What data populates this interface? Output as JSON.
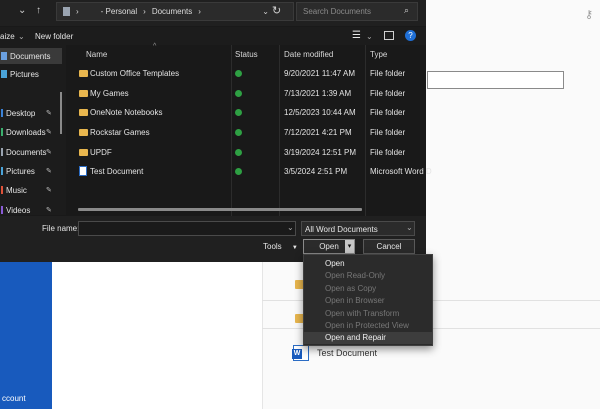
{
  "background": {
    "account_label": "ccount",
    "recent_doc": "Test Document"
  },
  "topbar": {
    "address_segments": [
      "›",
      "- Personal",
      "›",
      "Documents",
      "›"
    ],
    "search_placeholder": "Search Documents"
  },
  "toolbar": {
    "left_label": "aize",
    "new_folder": "New folder"
  },
  "sidebar": {
    "items": [
      {
        "label": "Documents",
        "icon": "documents-icon",
        "selected": true
      },
      {
        "label": "Pictures",
        "icon": "pictures-icon",
        "selected": false
      },
      {
        "label": "Desktop",
        "icon": "desktop-icon",
        "pinned": true
      },
      {
        "label": "Downloads",
        "icon": "downloads-icon",
        "pinned": true
      },
      {
        "label": "Documents",
        "icon": "documents-icon",
        "pinned": true
      },
      {
        "label": "Pictures",
        "icon": "pictures-icon",
        "pinned": true
      },
      {
        "label": "Music",
        "icon": "music-icon",
        "pinned": true
      },
      {
        "label": "Videos",
        "icon": "videos-icon",
        "pinned": true
      }
    ]
  },
  "columns": {
    "name": "Name",
    "status": "Status",
    "date": "Date modified",
    "type": "Type"
  },
  "files": [
    {
      "name": "Custom Office Templates",
      "date": "9/20/2021 11:47 AM",
      "type": "File folder",
      "kind": "folder"
    },
    {
      "name": "My Games",
      "date": "7/13/2021 1:39 AM",
      "type": "File folder",
      "kind": "folder"
    },
    {
      "name": "OneNote Notebooks",
      "date": "12/5/2023 10:44 AM",
      "type": "File folder",
      "kind": "folder"
    },
    {
      "name": "Rockstar Games",
      "date": "7/12/2021 4:21 PM",
      "type": "File folder",
      "kind": "folder"
    },
    {
      "name": "UPDF",
      "date": "3/19/2024 12:51 PM",
      "type": "File folder",
      "kind": "folder"
    },
    {
      "name": "Test Document",
      "date": "3/5/2024 2:51 PM",
      "type": "Microsoft Word D",
      "kind": "doc"
    }
  ],
  "bottom": {
    "file_name_label": "File name:",
    "file_name_value": "",
    "file_type": "All Word Documents",
    "tools": "Tools",
    "open": "Open",
    "cancel": "Cancel"
  },
  "open_menu": [
    {
      "label": "Open",
      "enabled": true
    },
    {
      "label": "Open Read-Only",
      "enabled": false
    },
    {
      "label": "Open as Copy",
      "enabled": false
    },
    {
      "label": "Open in Browser",
      "enabled": false
    },
    {
      "label": "Open with Transform",
      "enabled": false
    },
    {
      "label": "Open in Protected View",
      "enabled": false
    },
    {
      "label": "Open and Repair",
      "enabled": true,
      "hover": true
    }
  ],
  "colors": {
    "status_ok": "#2ea043",
    "folder": "#e8b64e",
    "word_blue": "#185abd"
  }
}
